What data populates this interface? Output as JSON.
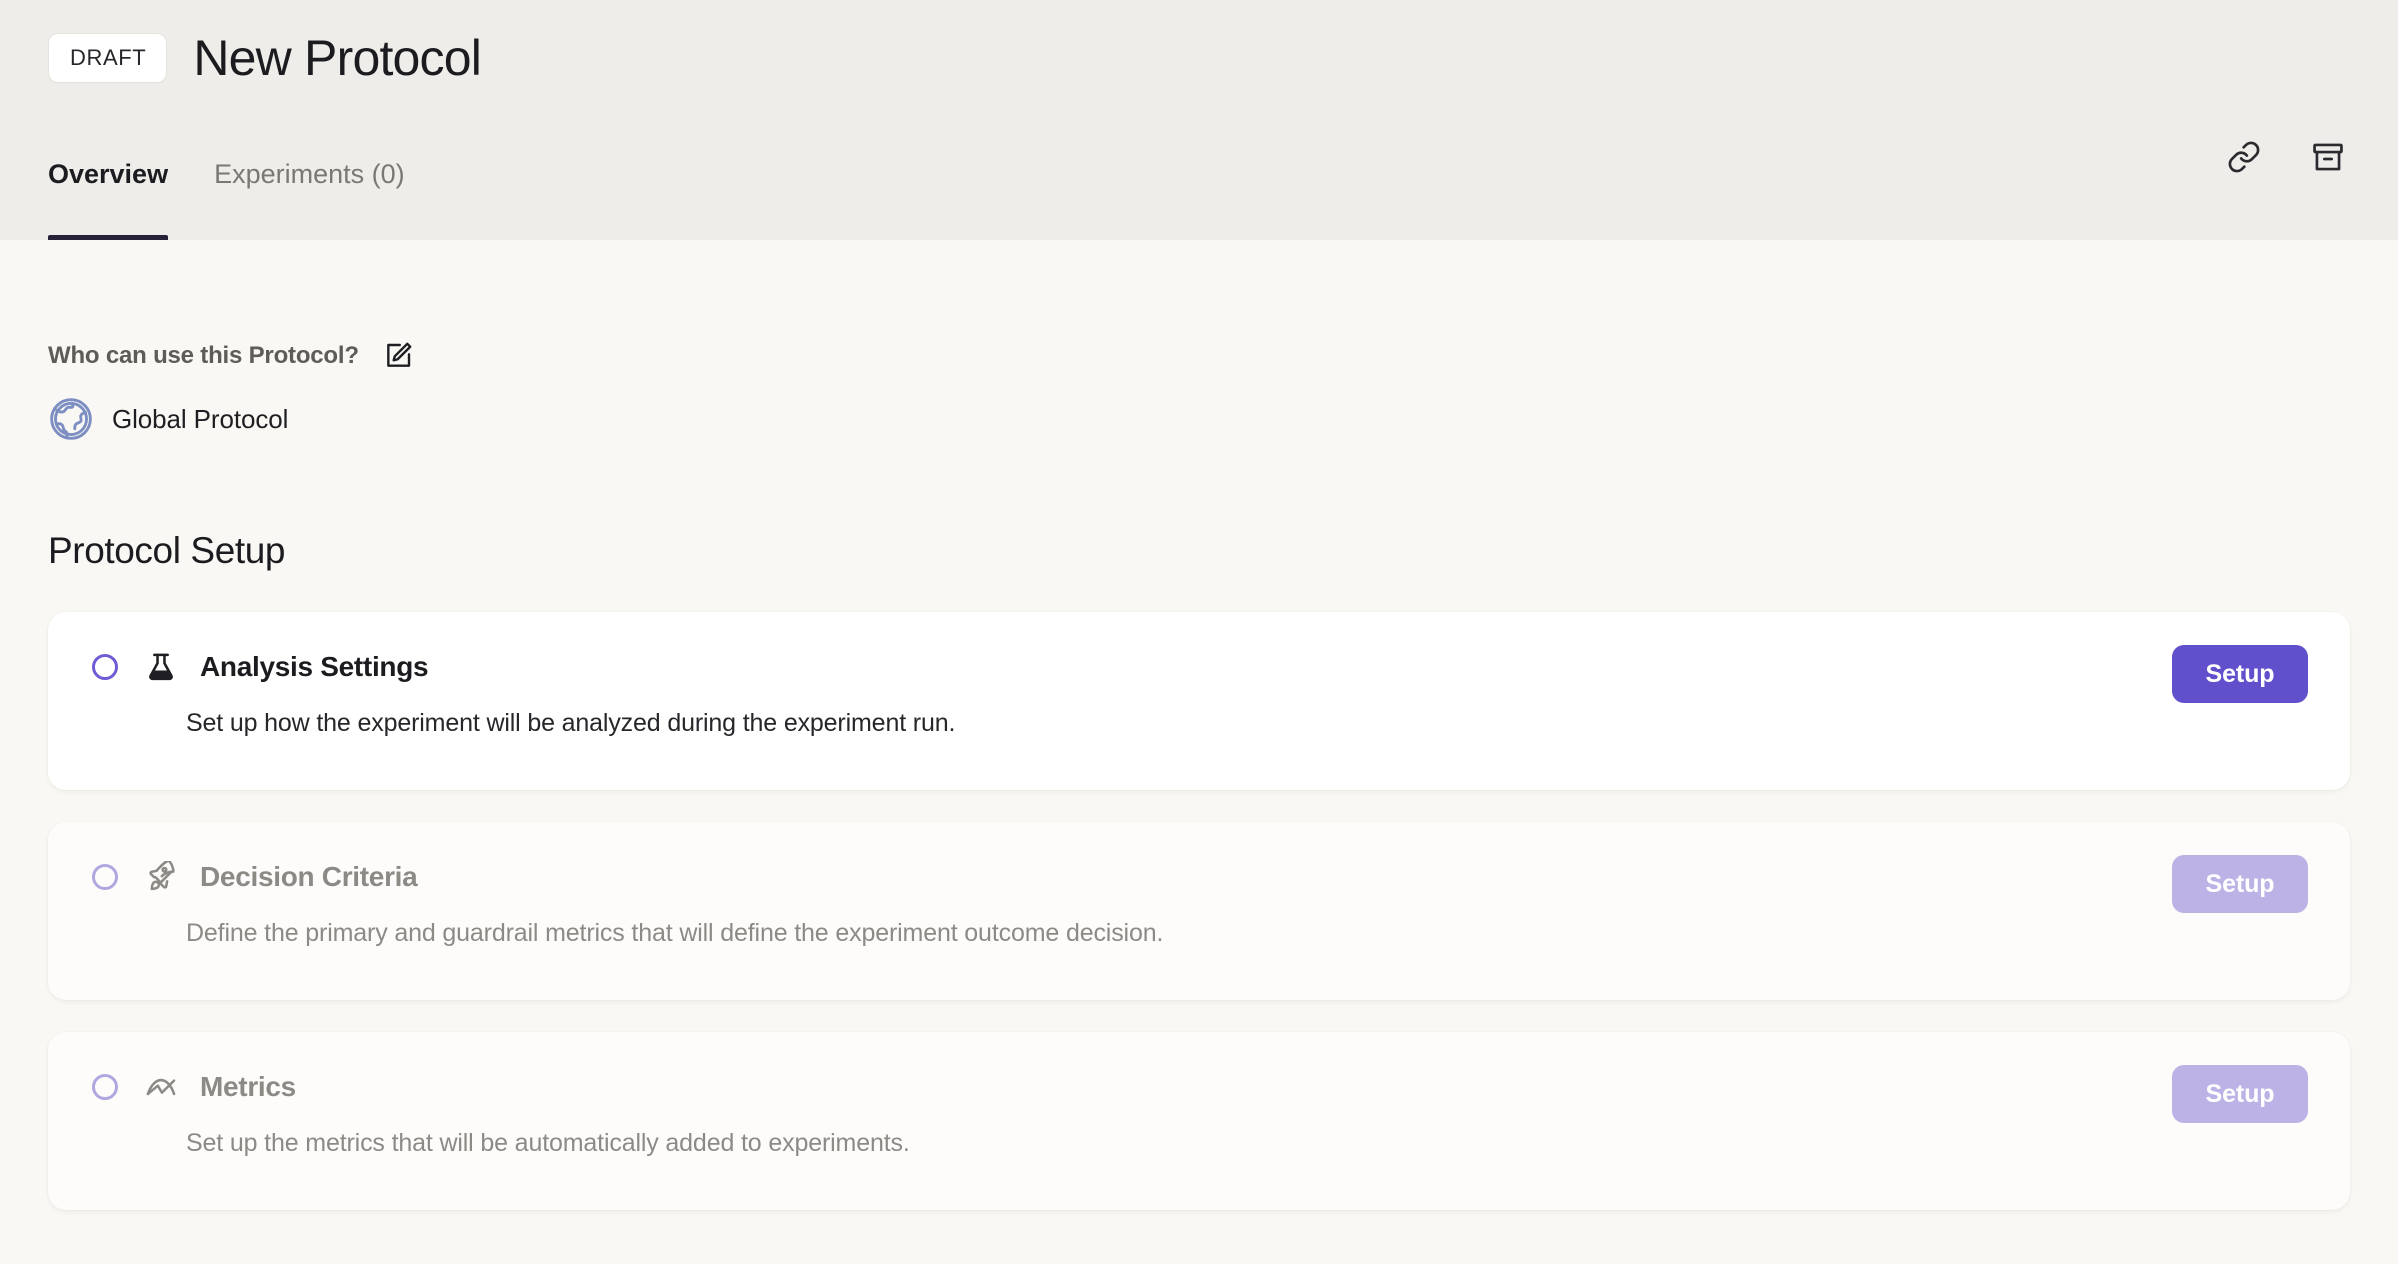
{
  "header": {
    "status_badge": "DRAFT",
    "title": "New Protocol",
    "tabs": [
      {
        "label": "Overview",
        "active": true
      },
      {
        "label": "Experiments (0)",
        "active": false
      }
    ],
    "actions": [
      {
        "name": "copy-link-button",
        "icon": "link-icon"
      },
      {
        "name": "archive-button",
        "icon": "archive-icon"
      }
    ]
  },
  "permissions": {
    "label": "Who can use this Protocol?",
    "edit_action": "edit-icon",
    "scope_icon": "globe-icon",
    "scope_value": "Global Protocol"
  },
  "setup": {
    "section_title": "Protocol Setup",
    "cards": [
      {
        "id": "analysis-settings",
        "icon": "flask-icon",
        "title": "Analysis Settings",
        "description": "Set up how the experiment will be analyzed during the experiment run.",
        "button_label": "Setup",
        "enabled": true,
        "completed": false
      },
      {
        "id": "decision-criteria",
        "icon": "rocket-icon",
        "title": "Decision Criteria",
        "description": "Define the primary and guardrail metrics that will define the experiment outcome decision.",
        "button_label": "Setup",
        "enabled": false,
        "completed": false
      },
      {
        "id": "metrics",
        "icon": "trend-chart-icon",
        "title": "Metrics",
        "description": "Set up the metrics that will be automatically added to experiments.",
        "button_label": "Setup",
        "enabled": false,
        "completed": false
      }
    ]
  },
  "colors": {
    "header_background": "#efedea",
    "page_background": "#faf8f4",
    "card_background": "#ffffff",
    "card_background_disabled": "#fdfcfa",
    "accent_purple": "#6150cc",
    "accent_purple_muted": "#bcb2e6",
    "radio_outline": "#6f5cd4",
    "radio_outline_disabled": "#b0a7e0",
    "tab_underline": "#27213a",
    "globe_blue": "#7d8ec2",
    "muted_text": "#8d8a86",
    "label_text": "#5f5c57"
  }
}
